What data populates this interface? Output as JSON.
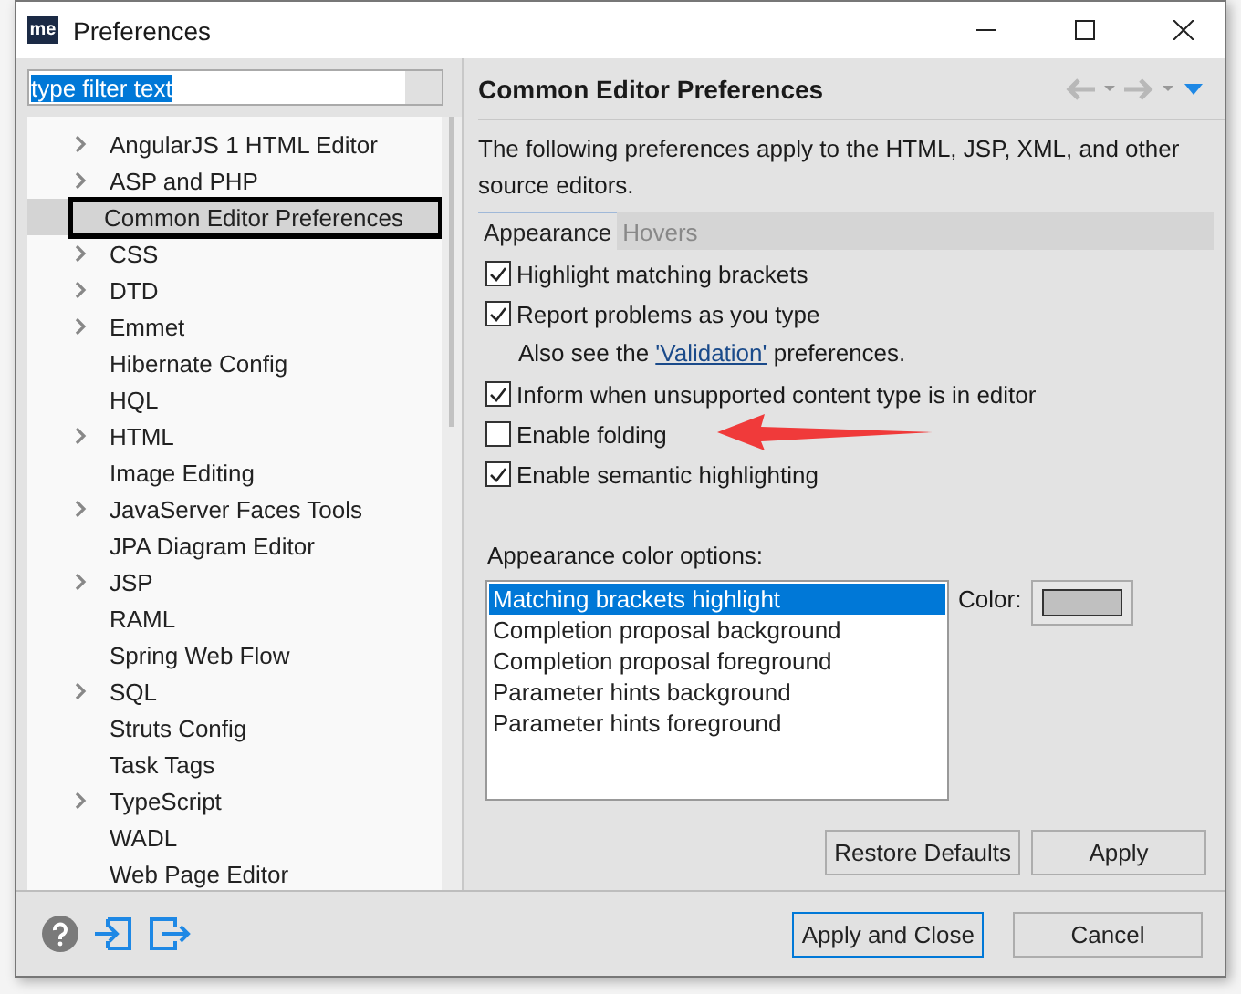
{
  "window": {
    "title": "Preferences",
    "logo": "me"
  },
  "filter": {
    "value": "type filter text"
  },
  "tree": {
    "items": [
      {
        "label": "AngularJS 1 HTML Editor",
        "expandable": true,
        "selected": false
      },
      {
        "label": "ASP and PHP",
        "expandable": true,
        "selected": false
      },
      {
        "label": "Common Editor Preferences",
        "expandable": false,
        "selected": true
      },
      {
        "label": "CSS",
        "expandable": true,
        "selected": false
      },
      {
        "label": "DTD",
        "expandable": true,
        "selected": false
      },
      {
        "label": "Emmet",
        "expandable": true,
        "selected": false
      },
      {
        "label": "Hibernate Config",
        "expandable": false,
        "selected": false
      },
      {
        "label": "HQL",
        "expandable": false,
        "selected": false
      },
      {
        "label": "HTML",
        "expandable": true,
        "selected": false
      },
      {
        "label": "Image Editing",
        "expandable": false,
        "selected": false
      },
      {
        "label": "JavaServer Faces Tools",
        "expandable": true,
        "selected": false
      },
      {
        "label": "JPA Diagram Editor",
        "expandable": false,
        "selected": false
      },
      {
        "label": "JSP",
        "expandable": true,
        "selected": false
      },
      {
        "label": "RAML",
        "expandable": false,
        "selected": false
      },
      {
        "label": "Spring Web Flow",
        "expandable": false,
        "selected": false
      },
      {
        "label": "SQL",
        "expandable": true,
        "selected": false
      },
      {
        "label": "Struts Config",
        "expandable": false,
        "selected": false
      },
      {
        "label": "Task Tags",
        "expandable": false,
        "selected": false
      },
      {
        "label": "TypeScript",
        "expandable": true,
        "selected": false
      },
      {
        "label": "WADL",
        "expandable": false,
        "selected": false
      },
      {
        "label": "Web Page Editor",
        "expandable": false,
        "selected": false
      }
    ]
  },
  "page": {
    "title": "Common Editor Preferences",
    "description": "The following preferences apply to the HTML, JSP, XML, and other source editors.",
    "tabs": [
      {
        "label": "Appearance",
        "selected": true
      },
      {
        "label": "Hovers",
        "selected": false
      }
    ],
    "options": [
      {
        "kind": "checkbox",
        "label": "Highlight matching brackets",
        "checked": true
      },
      {
        "kind": "checkbox",
        "label": "Report problems as you type",
        "checked": true
      },
      {
        "kind": "note",
        "prefix": "Also see the ",
        "link": "'Validation'",
        "suffix": " preferences."
      },
      {
        "kind": "checkbox",
        "label": "Inform when unsupported content type is in editor",
        "checked": true
      },
      {
        "kind": "checkbox",
        "label": "Enable folding",
        "checked": false
      },
      {
        "kind": "checkbox",
        "label": "Enable semantic highlighting",
        "checked": true
      }
    ],
    "color_options_label": "Appearance color options:",
    "color_options": [
      {
        "label": "Matching brackets highlight",
        "selected": true
      },
      {
        "label": "Completion proposal background",
        "selected": false
      },
      {
        "label": "Completion proposal foreground",
        "selected": false
      },
      {
        "label": "Parameter hints background",
        "selected": false
      },
      {
        "label": "Parameter hints foreground",
        "selected": false
      }
    ],
    "color_label": "Color:",
    "color_swatch": {
      "color": "#c0c0c0"
    },
    "buttons": [
      "Restore Defaults",
      "Apply"
    ]
  },
  "footer": {
    "buttons": [
      {
        "label": "Apply and Close",
        "default": true
      },
      {
        "label": "Cancel",
        "default": false
      }
    ]
  }
}
